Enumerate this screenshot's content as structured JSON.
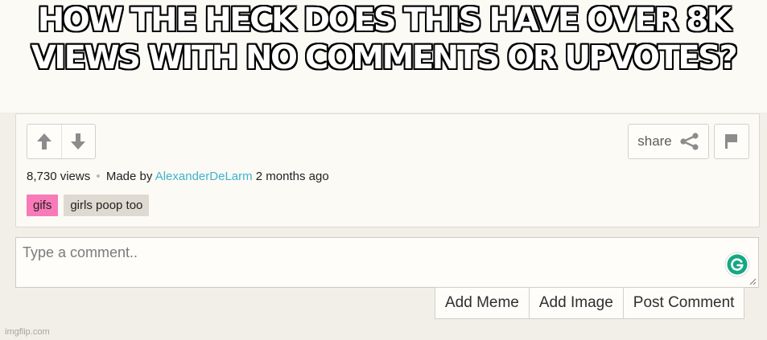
{
  "meme": {
    "caption": "HOW THE HECK DOES THIS HAVE OVER 8K VIEWS WITH NO COMMENTS OR UPVOTES?"
  },
  "post": {
    "views": "8,730 views",
    "separator": "•",
    "made_by": "Made by",
    "author": "AlexanderDeLarm",
    "time": "2 months ago",
    "share_label": "share",
    "tags": [
      {
        "label": "gifs",
        "color": "#f87ab8"
      },
      {
        "label": "girls poop too",
        "color": "#dedad2"
      }
    ],
    "icons": {
      "upvote": "arrow-up-icon",
      "downvote": "arrow-down-icon",
      "share": "share-icon",
      "flag": "flag-icon"
    }
  },
  "comment": {
    "placeholder": "Type a comment..",
    "grammarly_icon": "grammarly-icon"
  },
  "actions": {
    "add_meme": "Add Meme",
    "add_image": "Add Image",
    "post_comment": "Post Comment"
  },
  "watermark": "imgflip.com",
  "colors": {
    "author_link": "#3eb4cd",
    "grammarly": "#15a883"
  }
}
